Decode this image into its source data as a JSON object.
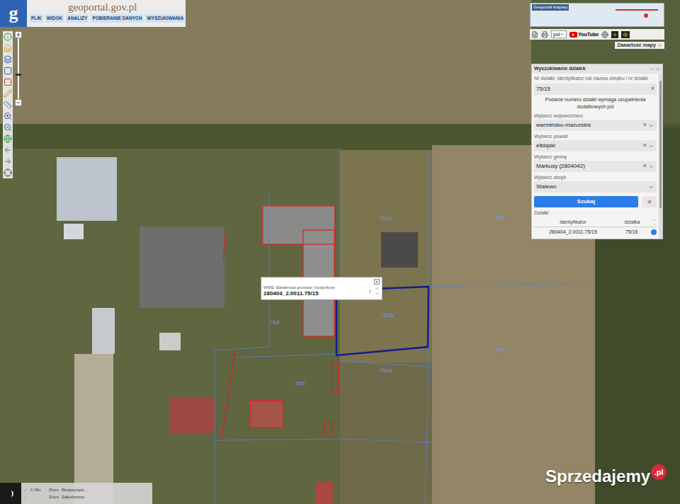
{
  "header": {
    "logo_letter": "g",
    "logo_text": "geoportal.gov.pl",
    "menu": [
      "PLIK",
      "WIDOK",
      "ANALIZY",
      "POBIERANIE DANYCH",
      "WYSZUKIWANIA"
    ]
  },
  "minimap": {
    "title": "Geoportal krajowy"
  },
  "toolbar": {
    "language": "pol",
    "youtube": "YouTube",
    "map_contents": "Zawartość mapy"
  },
  "search_panel": {
    "title": "Wyszukiwanie działek",
    "clear_glyph": "×",
    "number_field": {
      "label": "Nr działki, identyfikator lub nazwa obrębu i nr działki",
      "value": "75/15",
      "hint": "Podanie numeru działki wymaga uzupełnienia dodatkowych pól"
    },
    "fields": [
      {
        "label": "Wybierz województwo",
        "value": "warmińsko-mazurskie",
        "clearable": true
      },
      {
        "label": "Wybierz powiat",
        "value": "elbląski",
        "clearable": true
      },
      {
        "label": "Wybierz gminę",
        "value": "Markusy (2804042)",
        "clearable": true
      },
      {
        "label": "Wybierz obręb",
        "value": "Stalewo",
        "clearable": false
      }
    ],
    "search_button": "Szukaj",
    "cancel_glyph": "×",
    "results_title": "Działki",
    "columns": [
      "identyfikator",
      "działka"
    ],
    "rows": [
      {
        "id": "280404_2.0011.75/15",
        "parcel": "75/15"
      }
    ]
  },
  "popup": {
    "layer": "WMS: Ewidencja gruntów i budynków:",
    "id": "280404_2.0011.75/15"
  },
  "parcel_labels": [
    {
      "text": "75/12"
    },
    {
      "text": "75/1"
    },
    {
      "text": "75/4"
    },
    {
      "text": "75/15"
    },
    {
      "text": "75/5"
    },
    {
      "text": "75/14"
    },
    {
      "text": "75/6"
    }
  ],
  "status": [
    {
      "layer": "Zrom",
      "message": "Rozpoczęto...",
      "time": "6.98s"
    },
    {
      "layer": "Zrom",
      "message": "Zakończono"
    }
  ],
  "watermark": {
    "name": "Sprzedajemy",
    "suffix": ".pl"
  }
}
